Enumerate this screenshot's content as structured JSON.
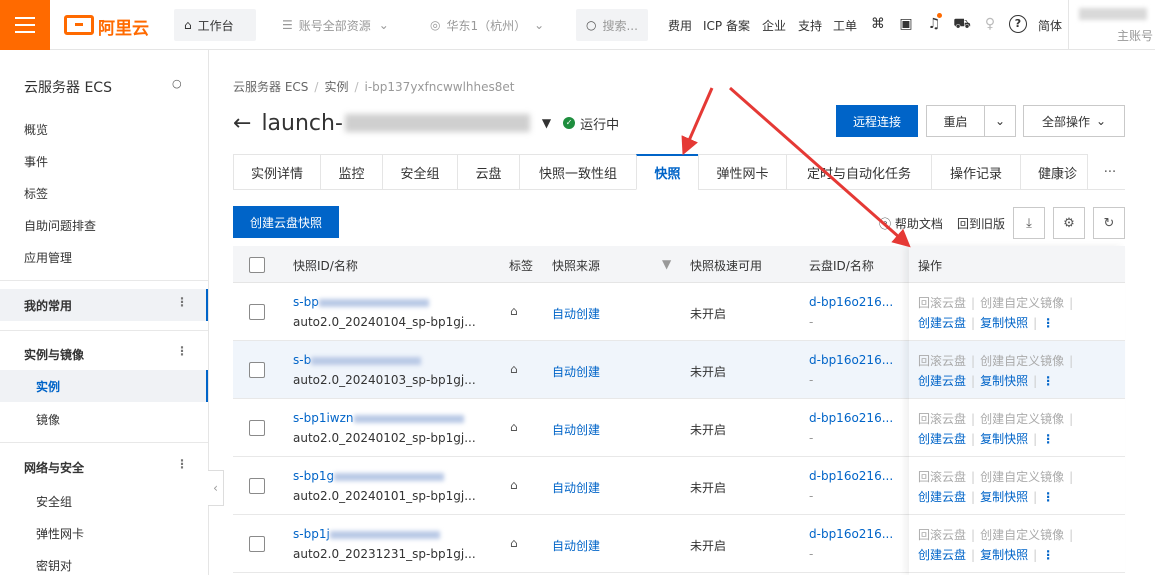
{
  "topbar": {
    "logo_text": "阿里云",
    "workbench": "工作台",
    "resources": "账号全部资源",
    "region": "华东1（杭州）",
    "search_placeholder": "搜索...",
    "links": [
      "费用",
      "ICP 备案",
      "企业",
      "支持",
      "工单"
    ],
    "lang": "简体",
    "account_label": "主账号"
  },
  "sidebar": {
    "title": "云服务器 ECS",
    "items_top": [
      "概览",
      "事件",
      "标签",
      "自助问题排查",
      "应用管理"
    ],
    "group_favorites": "我的常用",
    "group_instances": "实例与镜像",
    "instances_items": [
      "实例",
      "镜像"
    ],
    "group_network": "网络与安全",
    "network_items": [
      "安全组",
      "弹性网卡",
      "密钥对"
    ]
  },
  "breadcrumb": {
    "items": [
      "云服务器 ECS",
      "实例",
      "i-bp137yxfncwwlhhes8et"
    ]
  },
  "instance": {
    "name_prefix": "launch-",
    "name_suffix": "",
    "status": "运行中"
  },
  "actions": {
    "remote": "远程连接",
    "restart": "重启",
    "all_ops": "全部操作"
  },
  "tabs": {
    "items": [
      "实例详情",
      "监控",
      "安全组",
      "云盘",
      "快照一致性组",
      "快照",
      "弹性网卡",
      "定时与自动化任务",
      "操作记录",
      "健康诊"
    ],
    "active_index": 5,
    "more": "···"
  },
  "toolbar": {
    "create": "创建云盘快照",
    "help": "帮助文档",
    "old": "回到旧版"
  },
  "table": {
    "headers": {
      "id": "快照ID/名称",
      "tag": "标签",
      "source": "快照来源",
      "speed": "快照极速可用",
      "disk": "云盘ID/名称",
      "ops": "操作"
    },
    "rows": [
      {
        "id": "s-bp",
        "name": "auto2.0_20240104_sp-bp1gj...",
        "source": "自动创建",
        "speed": "未开启",
        "disk": "d-bp16o216...",
        "disk_name": "-"
      },
      {
        "id": "s-b",
        "name": "auto2.0_20240103_sp-bp1gj...",
        "source": "自动创建",
        "speed": "未开启",
        "disk": "d-bp16o216...",
        "disk_name": "-"
      },
      {
        "id": "s-bp1iwzn",
        "name": "auto2.0_20240102_sp-bp1gj...",
        "source": "自动创建",
        "speed": "未开启",
        "disk": "d-bp16o216...",
        "disk_name": "-"
      },
      {
        "id": "s-bp1g",
        "name": "auto2.0_20240101_sp-bp1gj...",
        "source": "自动创建",
        "speed": "未开启",
        "disk": "d-bp16o216...",
        "disk_name": "-"
      },
      {
        "id": "s-bp1j",
        "name": "auto2.0_20231231_sp-bp1gj...",
        "source": "自动创建",
        "speed": "未开启",
        "disk": "d-bp16o216...",
        "disk_name": "-"
      }
    ],
    "ops": {
      "rollback": "回滚云盘",
      "create_image": "创建自定义镜像",
      "create_disk": "创建云盘",
      "copy": "复制快照",
      "more": "⋮"
    }
  },
  "colors": {
    "brand": "#ff6a00",
    "primary": "#0064c8",
    "success": "#1e8e3e",
    "annotation": "#e53935"
  }
}
